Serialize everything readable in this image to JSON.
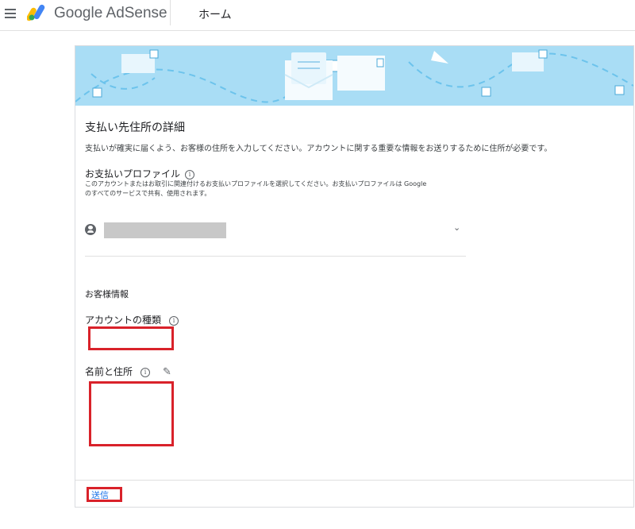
{
  "header": {
    "brand_prefix": "Google",
    "brand_name": "AdSense",
    "page_title": "ホーム"
  },
  "section": {
    "title": "支払い先住所の詳細",
    "description": "支払いが確実に届くよう、お客様の住所を入力してください。アカウントに関する重要な情報をお送りするために住所が必要です。"
  },
  "profile": {
    "label": "お支払いプロファイル",
    "description_line1": "このアカウントまたはお取引に関連付けるお支払いプロファイルを選択してください。お支払いプロファイルは Google",
    "description_line2": "のすべてのサービスで共有、使用されます。"
  },
  "customer": {
    "heading": "お客様情報",
    "account_type_label": "アカウントの種類",
    "name_address_label": "名前と住所"
  },
  "footer": {
    "submit_label": "送信"
  },
  "colors": {
    "banner": "#a9ddf5",
    "highlight": "#d9222a",
    "link": "#1a73e8"
  },
  "icons": [
    "menu-icon",
    "adsense-logo",
    "info-icon",
    "person-icon",
    "chevron-down-icon",
    "pencil-icon"
  ]
}
